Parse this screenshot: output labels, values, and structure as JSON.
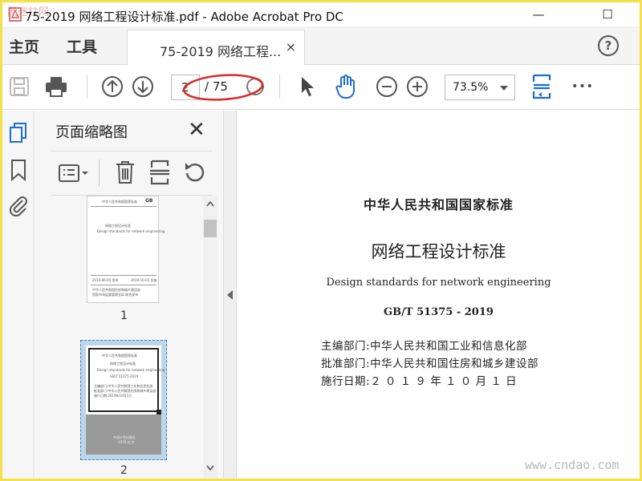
{
  "window": {
    "title": "75-2019 网络工程设计标准.pdf - Adobe Acrobat Pro DC",
    "minimize": "—",
    "maximize": "☐"
  },
  "tabs": {
    "home": "主页",
    "tools": "工具",
    "document_tab": "75-2019 网络工程...",
    "close": "×",
    "help": "?"
  },
  "toolbar": {
    "current_page": "2",
    "page_total": "/ 75",
    "zoom": "73.5%",
    "more": "•••"
  },
  "sidebar": {
    "panel_title": "页面缩略图",
    "close": "✕"
  },
  "thumbnails": [
    {
      "page_label": "1"
    },
    {
      "page_label": "2"
    }
  ],
  "document": {
    "heading": "中华人民共和国国家标准",
    "title": "网络工程设计标准",
    "english_title": "Design standards for network engineering",
    "code": "GB/T 51375 - 2019",
    "editor_label": "主编部门:",
    "editor_value": "中华人民共和国工业和信息化部",
    "approver_label": "批准部门:",
    "approver_value": "中华人民共和国住房和城乡建设部",
    "date_label": "施行日期:",
    "date_value": "２ ０ １ ９ 年 １ ０ 月 １ 日"
  },
  "watermark": "www.cndao.com",
  "corner_watermark": "图迷柱网",
  "colors": {
    "accent_blue": "#1e6dd0",
    "annotation_red": "#d62b2b",
    "frame_yellow": "#f4e04a"
  }
}
